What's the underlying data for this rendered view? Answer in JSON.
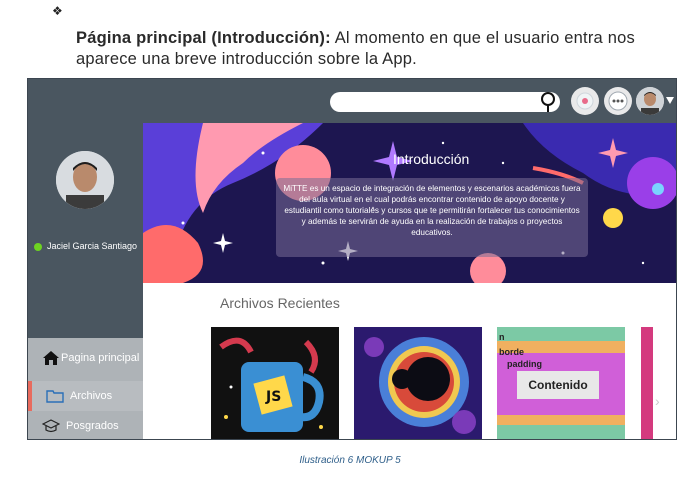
{
  "document": {
    "bullet": "❖",
    "heading": "Página principal (Introducción):",
    "text": " Al momento en que el usuario entra nos aparece una breve introducción sobre la App.",
    "caption": "Ilustración 6 MOKUP 5"
  },
  "app": {
    "search": {
      "placeholder": ""
    },
    "user": {
      "name": "Jaciel Garcia Santiago",
      "status_color": "#6ed321"
    },
    "nav": [
      {
        "label": "Pagina principal",
        "icon": "home-icon"
      },
      {
        "label": "Archivos",
        "icon": "folder-icon"
      },
      {
        "label": "Posgrados",
        "icon": "graduation-cap-icon"
      }
    ],
    "hero": {
      "title": "Introducción",
      "body": "MiTTE es un espacio de integración de elementos y escenarios académicos fuera del aula virtual en el cual podrás encontrar contenido de apoyo docente y estudiantil como tutoriales y cursos que te permitirán fortalecer tus conocimientos y además  te servirán de ayuda en la realización de trabajos o proyectos educativos."
    },
    "recent": {
      "heading": "Archivos Recientes",
      "box_model": {
        "n": "n",
        "border": "borde",
        "padding": "padding",
        "content": "Contenido"
      },
      "js_label": "JS"
    }
  },
  "colors": {
    "accent": "#e86b5e",
    "topbar": "#4a5660",
    "nav": "#aeb3b7"
  }
}
